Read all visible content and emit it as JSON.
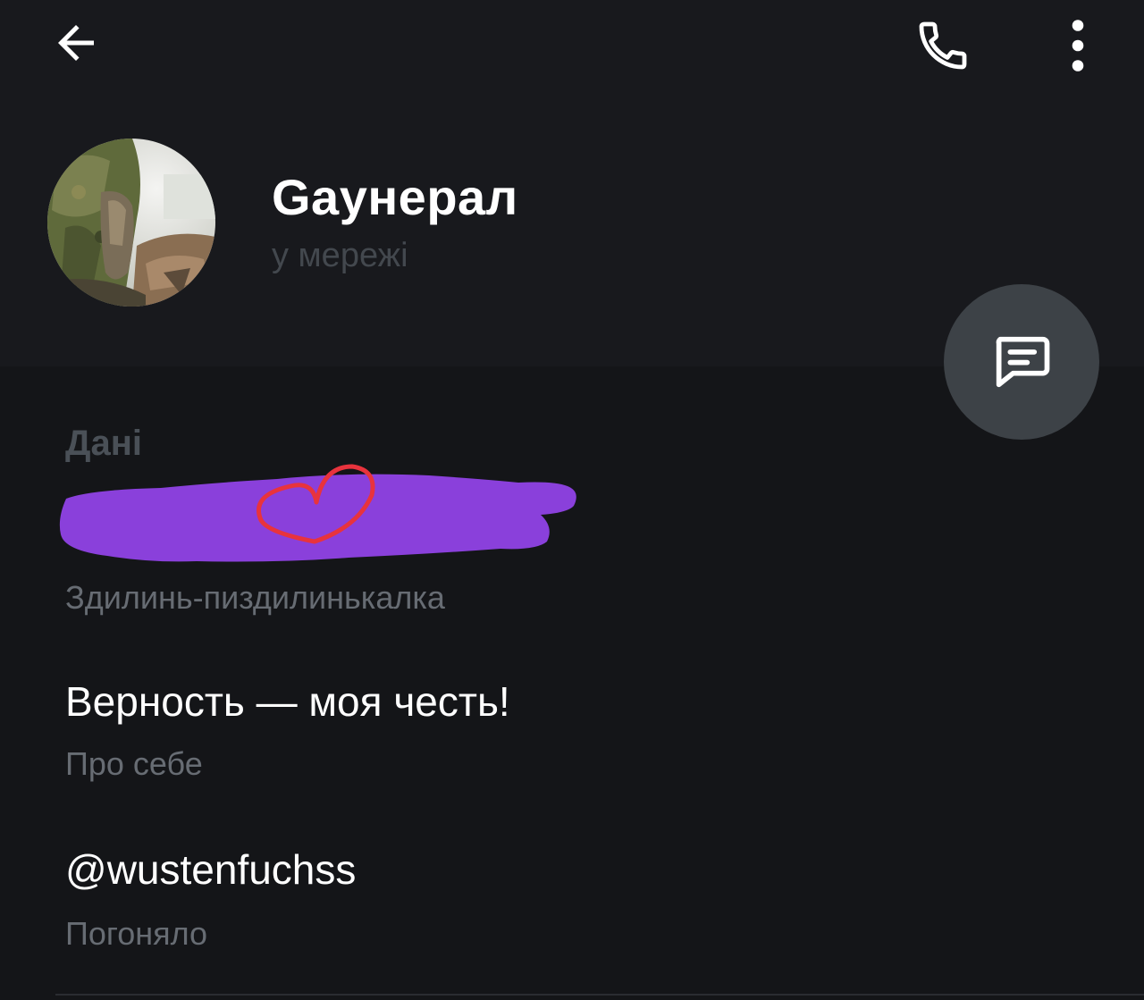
{
  "profile": {
    "name": "Gаунерал",
    "status": "у мережі"
  },
  "info": {
    "section_title": "Дані",
    "phone_caption": "Здилинь-пиздилинькалка",
    "bio_value": "Верность — моя честь!",
    "bio_caption": "Про себе",
    "username_value": "@wustenfuchss",
    "username_caption": "Погоняло"
  },
  "icons": {
    "back": "arrow-back-icon",
    "call": "phone-icon",
    "more": "more-vertical-icon",
    "message": "message-icon"
  },
  "colors": {
    "background": "#141518",
    "header": "#18191d",
    "fab": "#3d4247",
    "redaction": "#8a40db",
    "heart": "#e8333d"
  }
}
